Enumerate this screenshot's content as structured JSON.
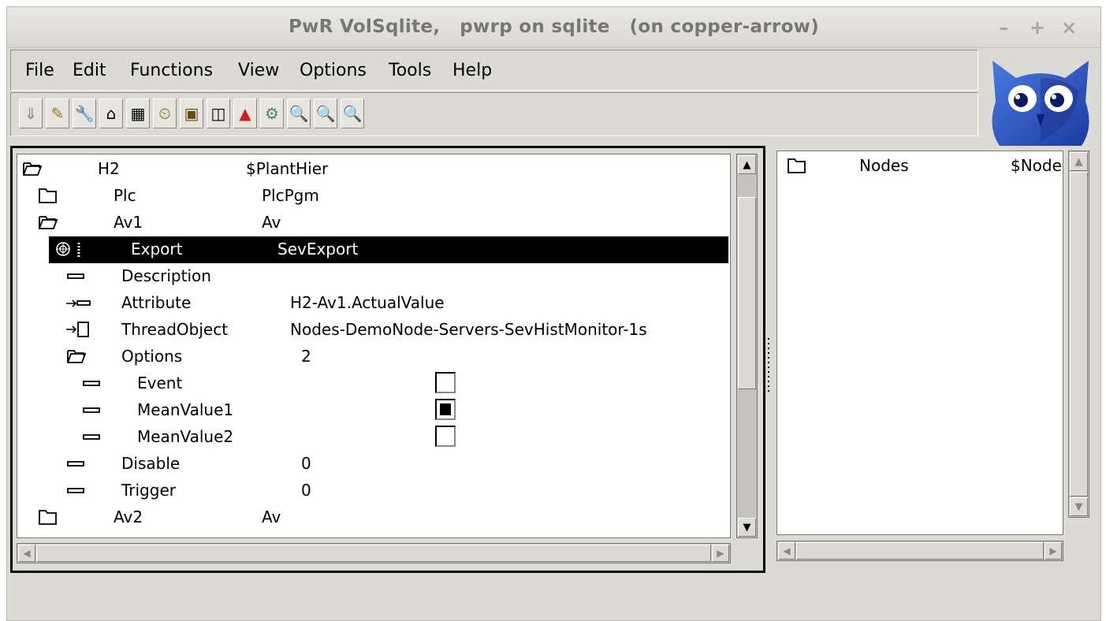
{
  "window": {
    "title": "PwR VolSqlite,   pwrp on sqlite   (on copper-arrow)",
    "controls": {
      "minimize": "–",
      "maximize": "+",
      "close": "×"
    }
  },
  "menu": [
    "File",
    "Edit",
    "Functions",
    "View",
    "Options",
    "Tools",
    "Help"
  ],
  "toolbar": {
    "buttons": [
      {
        "name": "save-icon",
        "glyph": "⇓"
      },
      {
        "name": "edit-pencil-icon",
        "glyph": "✎"
      },
      {
        "name": "wrench-icon",
        "glyph": "🔧"
      },
      {
        "name": "utilities-icon",
        "glyph": "⌂"
      },
      {
        "name": "configure-icon",
        "glyph": "▦"
      },
      {
        "name": "build-icon",
        "glyph": "⏲"
      },
      {
        "name": "distribute-icon",
        "glyph": "▣"
      },
      {
        "name": "book-icon",
        "glyph": "◫"
      },
      {
        "name": "alarm-icon",
        "glyph": "▲"
      },
      {
        "name": "link-icon",
        "glyph": "⚙"
      },
      {
        "name": "zoom-in-icon",
        "glyph": "🔍"
      },
      {
        "name": "zoom-out-icon",
        "glyph": "🔍"
      },
      {
        "name": "zoom-reset-icon",
        "glyph": "🔍"
      }
    ]
  },
  "left_tree": {
    "rows": [
      {
        "icon": "folder-open-icon",
        "name": "H2",
        "class_or_value": "$PlantHier"
      },
      {
        "icon": "folder-icon",
        "name": "Plc",
        "class_or_value": "PlcPgm"
      },
      {
        "icon": "folder-open-icon",
        "name": "Av1",
        "class_or_value": "Av"
      },
      {
        "icon": "object-icon",
        "name": "Export",
        "class_or_value": "SevExport",
        "selected": true
      },
      {
        "icon": "attribute-icon",
        "name": "Description",
        "class_or_value": ""
      },
      {
        "icon": "attr-ref-icon",
        "name": "Attribute",
        "class_or_value": "H2-Av1.ActualValue"
      },
      {
        "icon": "object-ref-icon",
        "name": "ThreadObject",
        "class_or_value": "Nodes-DemoNode-Servers-SevHistMonitor-1s"
      },
      {
        "icon": "folder-open-icon",
        "name": "Options",
        "class_or_value": "2"
      },
      {
        "icon": "attribute-icon",
        "name": "Event",
        "checkbox": false
      },
      {
        "icon": "attribute-icon",
        "name": "MeanValue1",
        "checkbox": true
      },
      {
        "icon": "attribute-icon",
        "name": "MeanValue2",
        "checkbox": false
      },
      {
        "icon": "attribute-icon",
        "name": "Disable",
        "class_or_value": "0"
      },
      {
        "icon": "attribute-icon",
        "name": "Trigger",
        "class_or_value": "0"
      },
      {
        "icon": "folder-icon",
        "name": "Av2",
        "class_or_value": "Av"
      }
    ]
  },
  "right_tree": {
    "rows": [
      {
        "icon": "folder-icon",
        "name": "Nodes",
        "class_or_value": "$Node"
      }
    ]
  }
}
